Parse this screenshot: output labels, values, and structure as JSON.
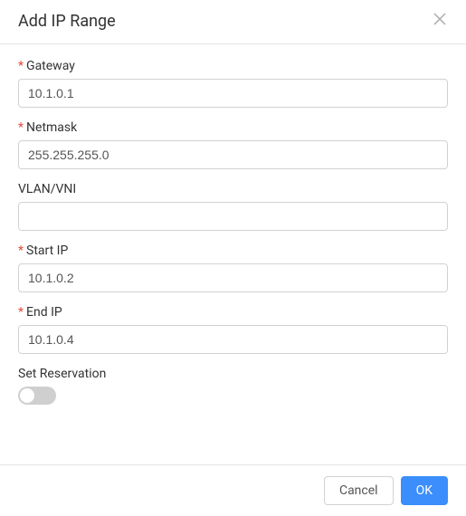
{
  "header": {
    "title": "Add IP Range"
  },
  "fields": {
    "gateway": {
      "label": "Gateway",
      "required": true,
      "value": "10.1.0.1"
    },
    "netmask": {
      "label": "Netmask",
      "required": true,
      "value": "255.255.255.0"
    },
    "vlan": {
      "label": "VLAN/VNI",
      "required": false,
      "value": ""
    },
    "startip": {
      "label": "Start IP",
      "required": true,
      "value": "10.1.0.2"
    },
    "endip": {
      "label": "End IP",
      "required": true,
      "value": "10.1.0.4"
    },
    "reservation": {
      "label": "Set Reservation",
      "on": false
    }
  },
  "footer": {
    "cancel": "Cancel",
    "ok": "OK"
  }
}
